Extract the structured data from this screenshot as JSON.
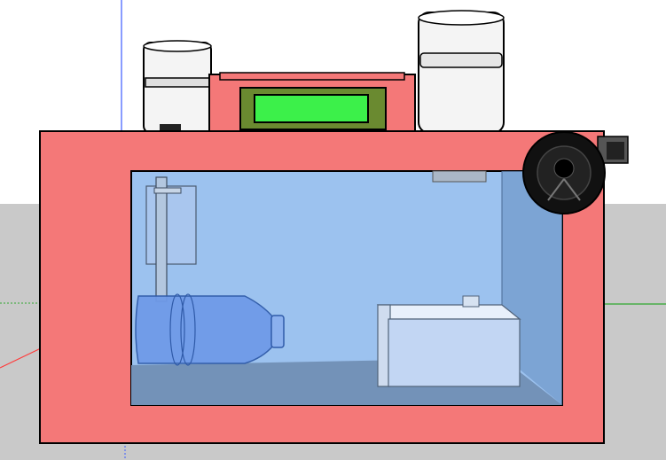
{
  "viewport": {
    "sky_color": "#ffffff",
    "ground_color": "#c9c9c9",
    "axes": {
      "red": "#ff3b3b",
      "green": "#2fa82f",
      "blue": "#3b5bff"
    }
  },
  "model": {
    "enclosure_color": "#f47878",
    "glass_color": "#9cc2ef",
    "floor_color": "#7392b8",
    "lcd_frame_color": "#6a8a30",
    "lcd_screen_color": "#3cf04a",
    "components": [
      {
        "name": "enclosure-box"
      },
      {
        "name": "lcd-display"
      },
      {
        "name": "left-cap-cylinder"
      },
      {
        "name": "right-cap-cylinder"
      },
      {
        "name": "water-bottle"
      },
      {
        "name": "sensor-probe-bracket"
      },
      {
        "name": "container-tray"
      },
      {
        "name": "side-fan"
      }
    ]
  }
}
